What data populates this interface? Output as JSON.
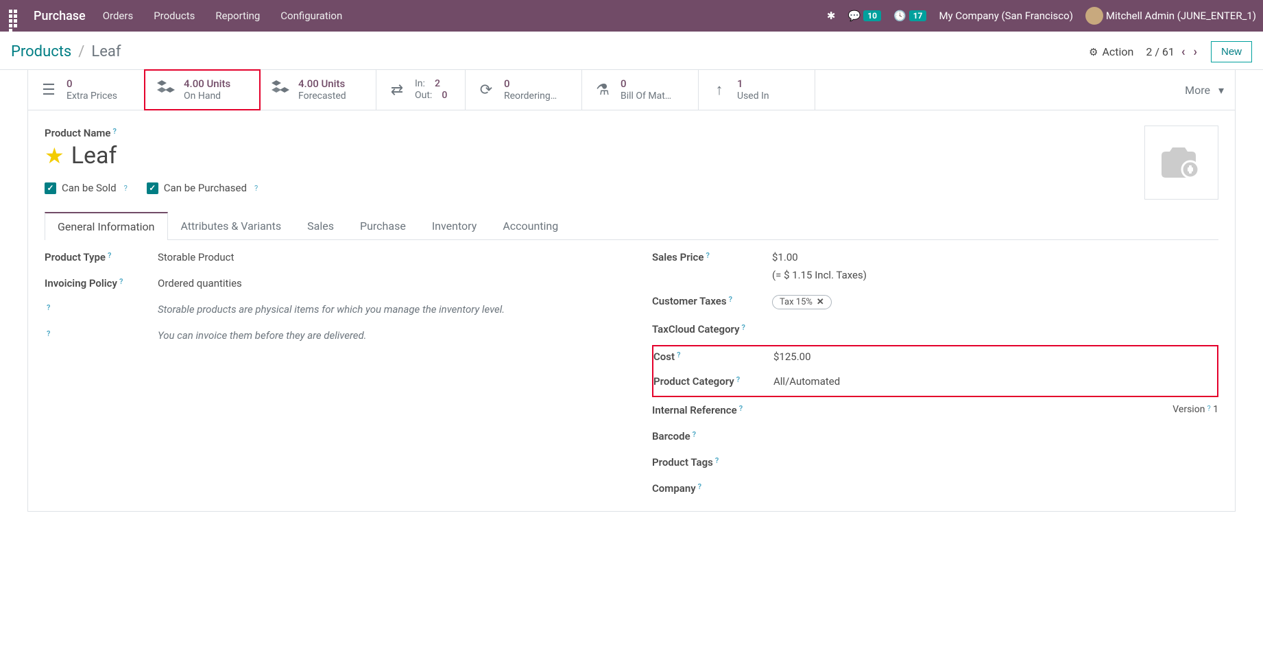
{
  "topbar": {
    "brand": "Purchase",
    "menu": [
      "Orders",
      "Products",
      "Reporting",
      "Configuration"
    ],
    "msg_count": "10",
    "activity_count": "17",
    "company": "My Company (San Francisco)",
    "user": "Mitchell Admin (JUNE_ENTER_1)"
  },
  "breadcrumb": {
    "parent": "Products",
    "current": "Leaf"
  },
  "controls": {
    "action_label": "Action",
    "pager": "2 / 61",
    "new_label": "New"
  },
  "stats": {
    "extra_prices": {
      "value": "0",
      "label": "Extra Prices"
    },
    "on_hand": {
      "value": "4.00 Units",
      "label": "On Hand"
    },
    "forecasted": {
      "value": "4.00 Units",
      "label": "Forecasted"
    },
    "in": {
      "label": "In:",
      "value": "2"
    },
    "out": {
      "label": "Out:",
      "value": "0"
    },
    "reordering": {
      "value": "0",
      "label": "Reordering…"
    },
    "bom": {
      "value": "0",
      "label": "Bill Of Mat…"
    },
    "used_in": {
      "value": "1",
      "label": "Used In"
    },
    "more": "More"
  },
  "form": {
    "product_name_label": "Product Name",
    "product_name": "Leaf",
    "can_be_sold": "Can be Sold",
    "can_be_purchased": "Can be Purchased"
  },
  "tabs": [
    "General Information",
    "Attributes & Variants",
    "Sales",
    "Purchase",
    "Inventory",
    "Accounting"
  ],
  "fields": {
    "left": {
      "product_type": {
        "label": "Product Type",
        "value": "Storable Product"
      },
      "invoicing_policy": {
        "label": "Invoicing Policy",
        "value": "Ordered quantities"
      },
      "desc1": "Storable products are physical items for which you manage the inventory level.",
      "desc2": "You can invoice them before they are delivered."
    },
    "right": {
      "sales_price": {
        "label": "Sales Price",
        "value": "$1.00",
        "extra": "(= $ 1.15 Incl. Taxes)"
      },
      "customer_taxes": {
        "label": "Customer Taxes",
        "value": "Tax 15%"
      },
      "taxcloud": {
        "label": "TaxCloud Category"
      },
      "cost": {
        "label": "Cost",
        "value": "$125.00"
      },
      "category": {
        "label": "Product Category",
        "value": "All/Automated"
      },
      "internal_ref": {
        "label": "Internal Reference"
      },
      "barcode": {
        "label": "Barcode"
      },
      "tags": {
        "label": "Product Tags"
      },
      "company": {
        "label": "Company"
      },
      "version": {
        "label": "Version",
        "value": "1"
      }
    }
  }
}
